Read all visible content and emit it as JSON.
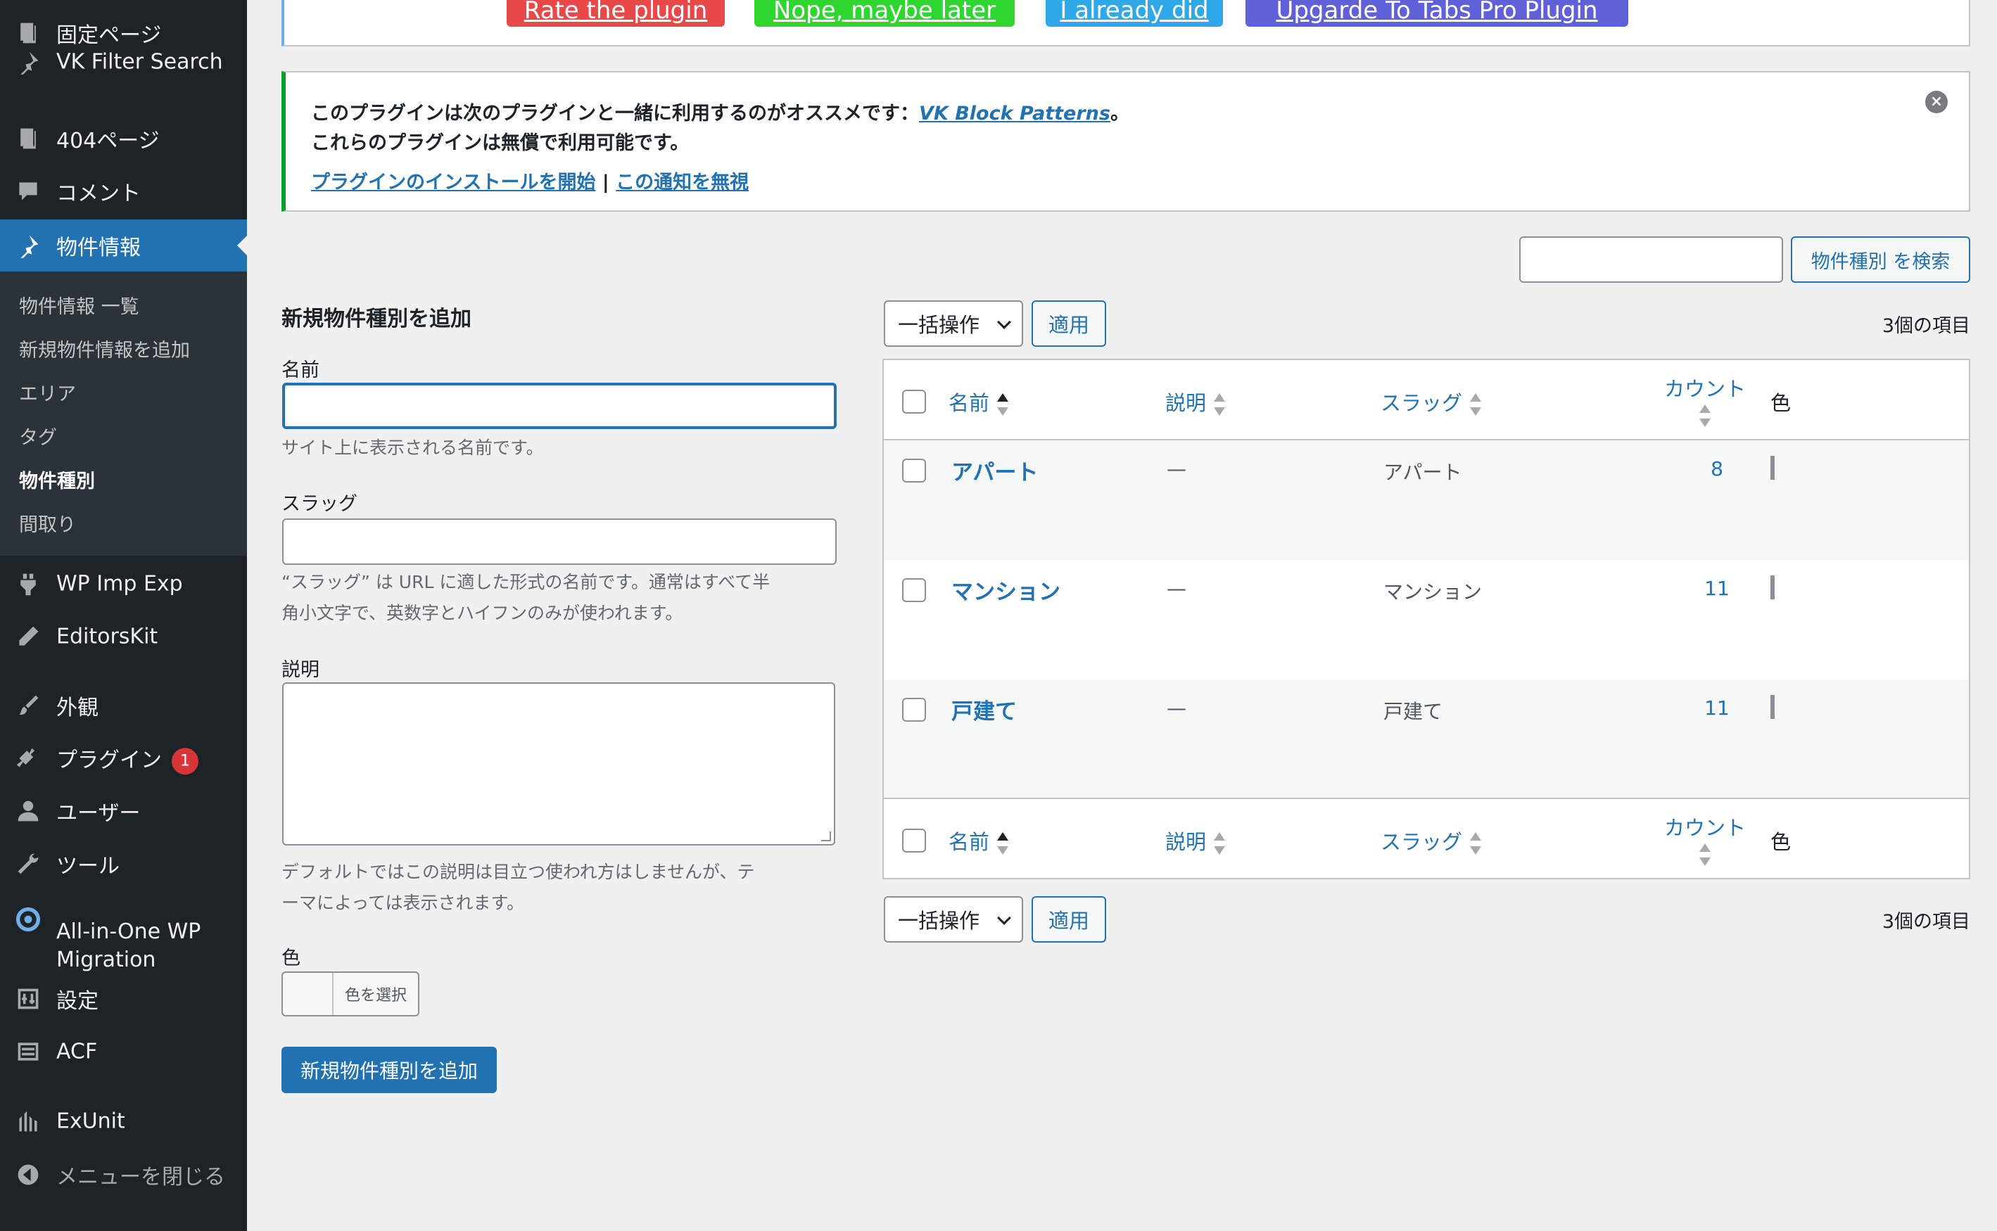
{
  "sidebar": {
    "items": [
      {
        "label": "固定ページ",
        "icon": "page-icon"
      },
      {
        "label": "VK Filter Search",
        "icon": "pin-icon"
      },
      {
        "label": "404ページ",
        "icon": "page-icon"
      },
      {
        "label": "コメント",
        "icon": "comment-icon"
      },
      {
        "label": "物件情報",
        "icon": "pin-icon"
      },
      {
        "label": "WP Imp Exp",
        "icon": "plugin-icon"
      },
      {
        "label": "EditorsKit",
        "icon": "pencil-icon"
      },
      {
        "label": "外観",
        "icon": "brush-icon"
      },
      {
        "label": "プラグイン",
        "icon": "plug-icon",
        "badge": "1"
      },
      {
        "label": "ユーザー",
        "icon": "user-icon"
      },
      {
        "label": "ツール",
        "icon": "wrench-icon"
      },
      {
        "label": "All-in-One WP",
        "label2": "Migration",
        "icon": "migration-icon"
      },
      {
        "label": "設定",
        "icon": "settings-icon"
      },
      {
        "label": "ACF",
        "icon": "acf-icon"
      },
      {
        "label": "ExUnit",
        "icon": "exunit-icon"
      },
      {
        "label": "メニューを閉じる",
        "icon": "collapse-icon"
      }
    ],
    "submenu": [
      "物件情報 一覧",
      "新規物件情報を追加",
      "エリア",
      "タグ",
      "物件種別",
      "間取り"
    ]
  },
  "promo": {
    "buttons": [
      {
        "label": "Rate the plugin",
        "color": "#e94848"
      },
      {
        "label": "Nope, maybe later",
        "color": "#2fd62f"
      },
      {
        "label": "I already did",
        "color": "#2ea8e6"
      },
      {
        "label": "Upgarde To Tabs Pro Plugin",
        "color": "#6060d8"
      }
    ]
  },
  "notice": {
    "line1_text": "このプラグインは次のプラグインと一緒に利用するのがオススメです：",
    "line1_link": "VK Block Patterns",
    "line1_end": "。",
    "line2": "これらのプラグインは無償で利用可能です。",
    "install_link": "プラグインのインストールを開始",
    "separator": "|",
    "dismiss_link": "この通知を無視"
  },
  "search": {
    "button": "物件種別 を検索",
    "value": ""
  },
  "form": {
    "heading": "新規物件種別を追加",
    "name_label": "名前",
    "name_help": "サイト上に表示される名前です。",
    "slug_label": "スラッグ",
    "slug_help_1": "“スラッグ” は URL に適した形式の名前です。通常はすべて半",
    "slug_help_2": "角小文字で、英数字とハイフンのみが使われます。",
    "desc_label": "説明",
    "desc_help_1": "デフォルトではこの説明は目立つ使われ方はしませんが、テ",
    "desc_help_2": "ーマによっては表示されます。",
    "color_label": "色",
    "color_button": "色を選択",
    "submit": "新規物件種別を追加"
  },
  "table": {
    "bulk_action": "一括操作",
    "apply": "適用",
    "items_count": "3個の項目",
    "columns": {
      "name": "名前",
      "description": "説明",
      "slug": "スラッグ",
      "count": "カウント",
      "color": "色"
    },
    "rows": [
      {
        "name": "アパート",
        "description": "—",
        "slug": "アパート",
        "count": "8"
      },
      {
        "name": "マンション",
        "description": "—",
        "slug": "マンション",
        "count": "11"
      },
      {
        "name": "戸建て",
        "description": "—",
        "slug": "戸建て",
        "count": "11"
      }
    ]
  },
  "colors": {
    "accent": "#2271b1",
    "sidebar_bg": "#1d2327",
    "notice_border": "#00a32a",
    "badge": "#d63638"
  }
}
